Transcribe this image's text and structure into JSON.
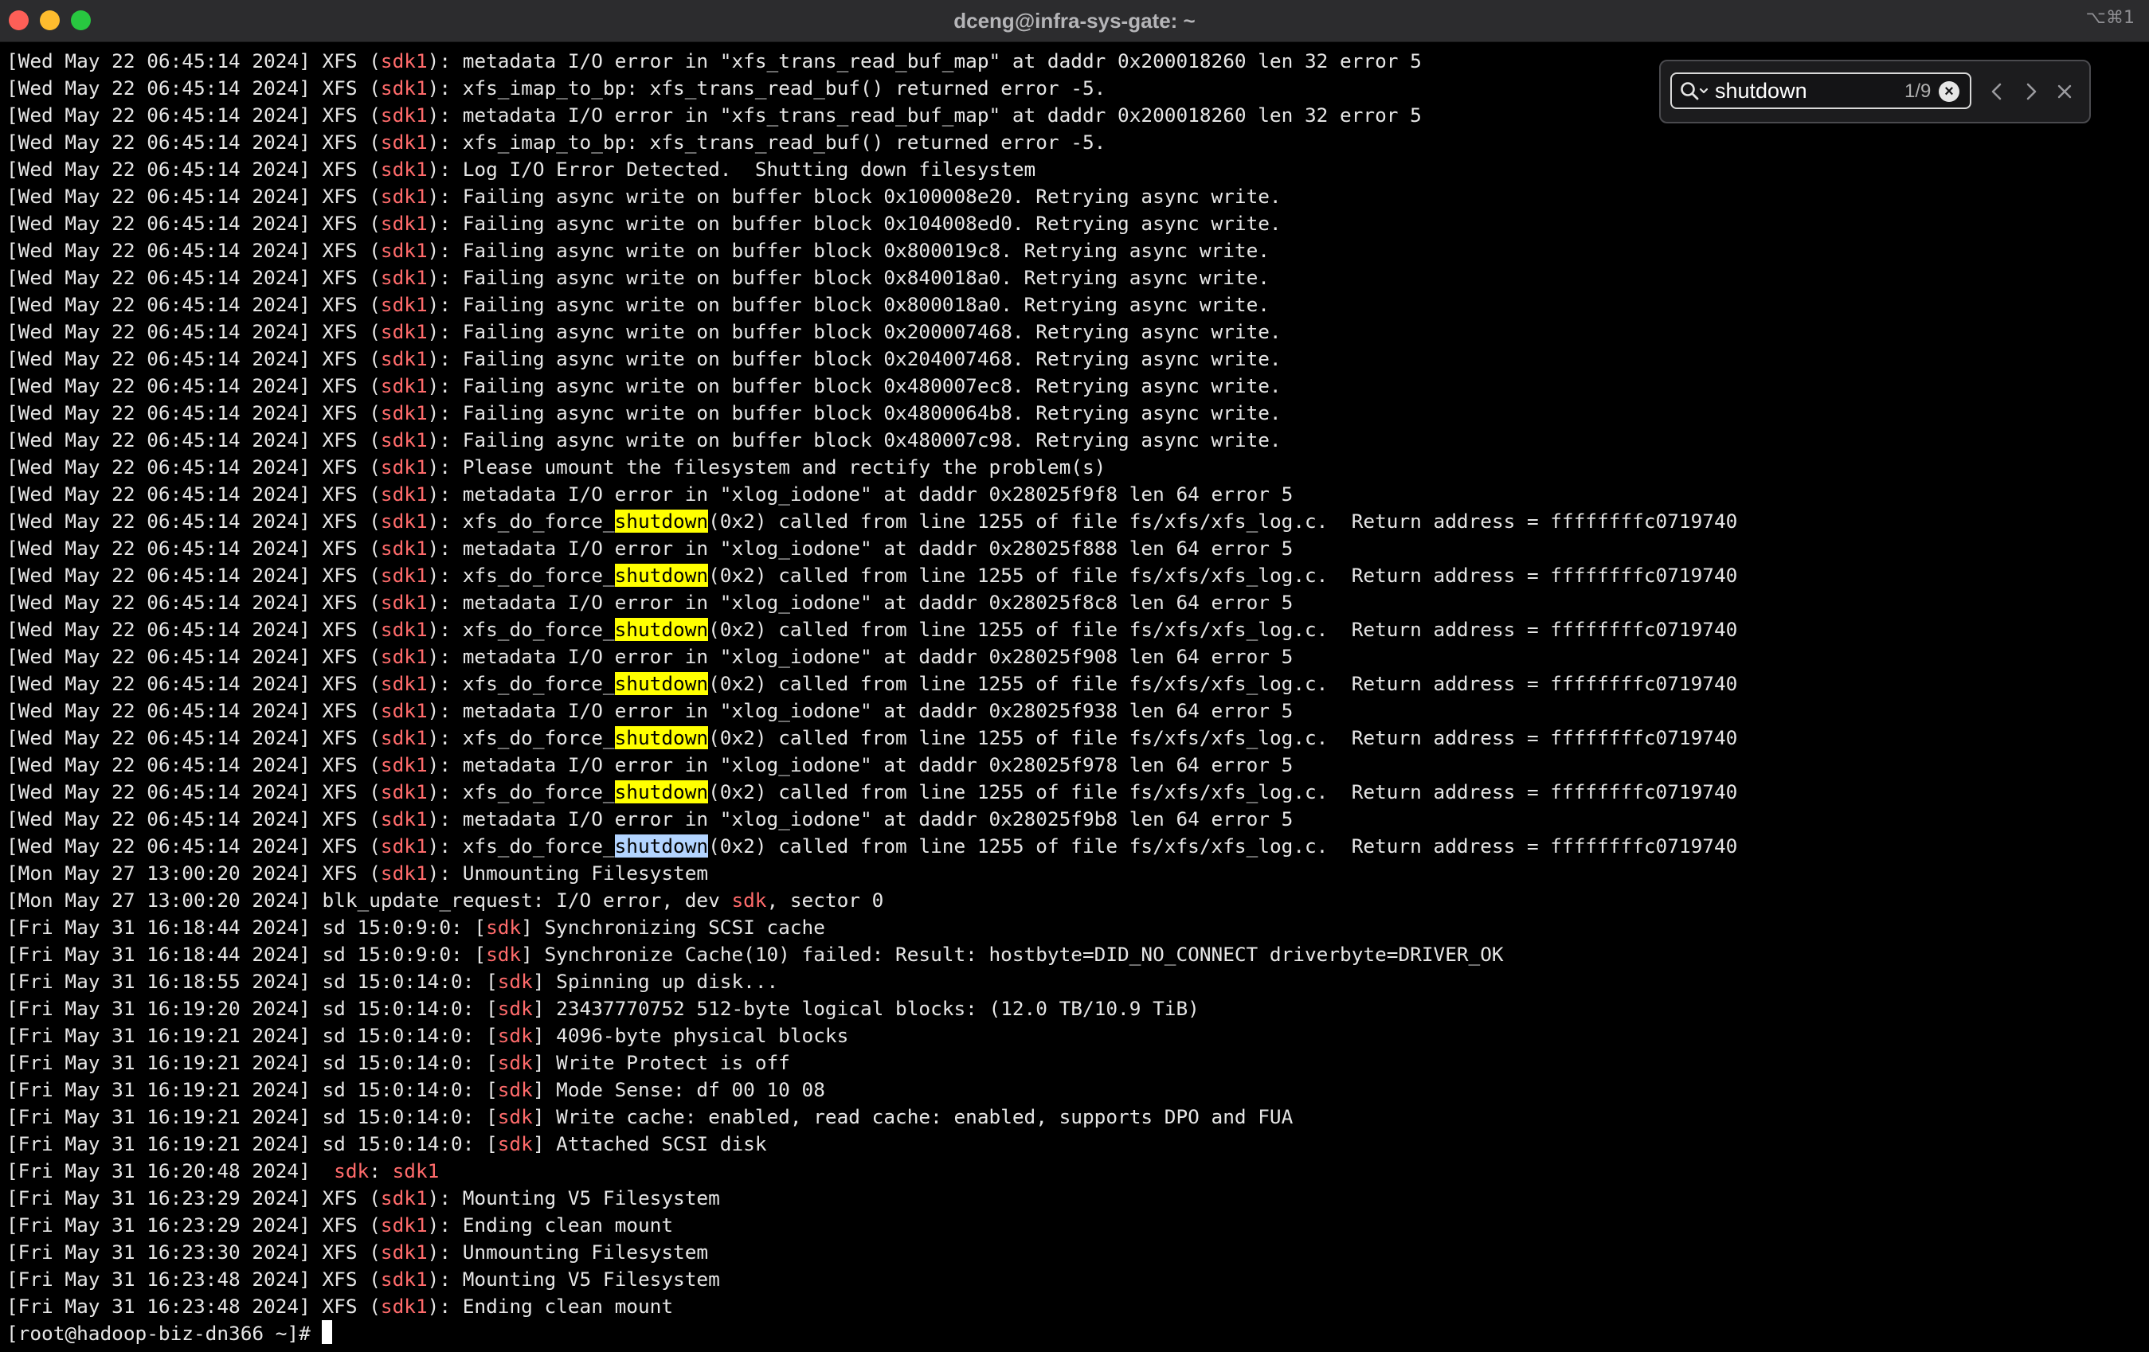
{
  "window": {
    "title": "dceng@infra-sys-gate: ~",
    "shortcut": "⌥⌘1"
  },
  "find": {
    "query": "shutdown",
    "count": "1/9",
    "clear_glyph": "×"
  },
  "prompt": "[root@hadoop-biz-dn366 ~]# ",
  "colors": {
    "highlight": "#ff6b6b",
    "match": "#ffff00",
    "current_match": "#b3d4ff"
  },
  "lines": [
    [
      {
        "t": "[Wed May 22 06:45:14 2024] XFS ("
      },
      {
        "t": "sdk1",
        "c": "hl"
      },
      {
        "t": "): metadata I/O error in \"xfs_trans_read_buf_map\" at daddr 0x200018260 len 32 error 5"
      }
    ],
    [
      {
        "t": "[Wed May 22 06:45:14 2024] XFS ("
      },
      {
        "t": "sdk1",
        "c": "hl"
      },
      {
        "t": "): xfs_imap_to_bp: xfs_trans_read_buf() returned error -5."
      }
    ],
    [
      {
        "t": "[Wed May 22 06:45:14 2024] XFS ("
      },
      {
        "t": "sdk1",
        "c": "hl"
      },
      {
        "t": "): metadata I/O error in \"xfs_trans_read_buf_map\" at daddr 0x200018260 len 32 error 5"
      }
    ],
    [
      {
        "t": "[Wed May 22 06:45:14 2024] XFS ("
      },
      {
        "t": "sdk1",
        "c": "hl"
      },
      {
        "t": "): xfs_imap_to_bp: xfs_trans_read_buf() returned error -5."
      }
    ],
    [
      {
        "t": "[Wed May 22 06:45:14 2024] XFS ("
      },
      {
        "t": "sdk1",
        "c": "hl"
      },
      {
        "t": "): Log I/O Error Detected.  Shutting down filesystem"
      }
    ],
    [
      {
        "t": "[Wed May 22 06:45:14 2024] XFS ("
      },
      {
        "t": "sdk1",
        "c": "hl"
      },
      {
        "t": "): Failing async write on buffer block 0x100008e20. Retrying async write."
      }
    ],
    [
      {
        "t": "[Wed May 22 06:45:14 2024] XFS ("
      },
      {
        "t": "sdk1",
        "c": "hl"
      },
      {
        "t": "): Failing async write on buffer block 0x104008ed0. Retrying async write."
      }
    ],
    [
      {
        "t": "[Wed May 22 06:45:14 2024] XFS ("
      },
      {
        "t": "sdk1",
        "c": "hl"
      },
      {
        "t": "): Failing async write on buffer block 0x800019c8. Retrying async write."
      }
    ],
    [
      {
        "t": "[Wed May 22 06:45:14 2024] XFS ("
      },
      {
        "t": "sdk1",
        "c": "hl"
      },
      {
        "t": "): Failing async write on buffer block 0x840018a0. Retrying async write."
      }
    ],
    [
      {
        "t": "[Wed May 22 06:45:14 2024] XFS ("
      },
      {
        "t": "sdk1",
        "c": "hl"
      },
      {
        "t": "): Failing async write on buffer block 0x800018a0. Retrying async write."
      }
    ],
    [
      {
        "t": "[Wed May 22 06:45:14 2024] XFS ("
      },
      {
        "t": "sdk1",
        "c": "hl"
      },
      {
        "t": "): Failing async write on buffer block 0x200007468. Retrying async write."
      }
    ],
    [
      {
        "t": "[Wed May 22 06:45:14 2024] XFS ("
      },
      {
        "t": "sdk1",
        "c": "hl"
      },
      {
        "t": "): Failing async write on buffer block 0x204007468. Retrying async write."
      }
    ],
    [
      {
        "t": "[Wed May 22 06:45:14 2024] XFS ("
      },
      {
        "t": "sdk1",
        "c": "hl"
      },
      {
        "t": "): Failing async write on buffer block 0x480007ec8. Retrying async write."
      }
    ],
    [
      {
        "t": "[Wed May 22 06:45:14 2024] XFS ("
      },
      {
        "t": "sdk1",
        "c": "hl"
      },
      {
        "t": "): Failing async write on buffer block 0x4800064b8. Retrying async write."
      }
    ],
    [
      {
        "t": "[Wed May 22 06:45:14 2024] XFS ("
      },
      {
        "t": "sdk1",
        "c": "hl"
      },
      {
        "t": "): Failing async write on buffer block 0x480007c98. Retrying async write."
      }
    ],
    [
      {
        "t": "[Wed May 22 06:45:14 2024] XFS ("
      },
      {
        "t": "sdk1",
        "c": "hl"
      },
      {
        "t": "): Please umount the filesystem and rectify the problem(s)"
      }
    ],
    [
      {
        "t": "[Wed May 22 06:45:14 2024] XFS ("
      },
      {
        "t": "sdk1",
        "c": "hl"
      },
      {
        "t": "): metadata I/O error in \"xlog_iodone\" at daddr 0x28025f9f8 len 64 error 5"
      }
    ],
    [
      {
        "t": "[Wed May 22 06:45:14 2024] XFS ("
      },
      {
        "t": "sdk1",
        "c": "hl"
      },
      {
        "t": "): xfs_do_force_"
      },
      {
        "t": "shutdown",
        "c": "match"
      },
      {
        "t": "(0x2) called from line 1255 of file fs/xfs/xfs_log.c.  Return address = ffffffffc0719740"
      }
    ],
    [
      {
        "t": "[Wed May 22 06:45:14 2024] XFS ("
      },
      {
        "t": "sdk1",
        "c": "hl"
      },
      {
        "t": "): metadata I/O error in \"xlog_iodone\" at daddr 0x28025f888 len 64 error 5"
      }
    ],
    [
      {
        "t": "[Wed May 22 06:45:14 2024] XFS ("
      },
      {
        "t": "sdk1",
        "c": "hl"
      },
      {
        "t": "): xfs_do_force_"
      },
      {
        "t": "shutdown",
        "c": "match"
      },
      {
        "t": "(0x2) called from line 1255 of file fs/xfs/xfs_log.c.  Return address = ffffffffc0719740"
      }
    ],
    [
      {
        "t": "[Wed May 22 06:45:14 2024] XFS ("
      },
      {
        "t": "sdk1",
        "c": "hl"
      },
      {
        "t": "): metadata I/O error in \"xlog_iodone\" at daddr 0x28025f8c8 len 64 error 5"
      }
    ],
    [
      {
        "t": "[Wed May 22 06:45:14 2024] XFS ("
      },
      {
        "t": "sdk1",
        "c": "hl"
      },
      {
        "t": "): xfs_do_force_"
      },
      {
        "t": "shutdown",
        "c": "match"
      },
      {
        "t": "(0x2) called from line 1255 of file fs/xfs/xfs_log.c.  Return address = ffffffffc0719740"
      }
    ],
    [
      {
        "t": "[Wed May 22 06:45:14 2024] XFS ("
      },
      {
        "t": "sdk1",
        "c": "hl"
      },
      {
        "t": "): metadata I/O error in \"xlog_iodone\" at daddr 0x28025f908 len 64 error 5"
      }
    ],
    [
      {
        "t": "[Wed May 22 06:45:14 2024] XFS ("
      },
      {
        "t": "sdk1",
        "c": "hl"
      },
      {
        "t": "): xfs_do_force_"
      },
      {
        "t": "shutdown",
        "c": "match"
      },
      {
        "t": "(0x2) called from line 1255 of file fs/xfs/xfs_log.c.  Return address = ffffffffc0719740"
      }
    ],
    [
      {
        "t": "[Wed May 22 06:45:14 2024] XFS ("
      },
      {
        "t": "sdk1",
        "c": "hl"
      },
      {
        "t": "): metadata I/O error in \"xlog_iodone\" at daddr 0x28025f938 len 64 error 5"
      }
    ],
    [
      {
        "t": "[Wed May 22 06:45:14 2024] XFS ("
      },
      {
        "t": "sdk1",
        "c": "hl"
      },
      {
        "t": "): xfs_do_force_"
      },
      {
        "t": "shutdown",
        "c": "match"
      },
      {
        "t": "(0x2) called from line 1255 of file fs/xfs/xfs_log.c.  Return address = ffffffffc0719740"
      }
    ],
    [
      {
        "t": "[Wed May 22 06:45:14 2024] XFS ("
      },
      {
        "t": "sdk1",
        "c": "hl"
      },
      {
        "t": "): metadata I/O error in \"xlog_iodone\" at daddr 0x28025f978 len 64 error 5"
      }
    ],
    [
      {
        "t": "[Wed May 22 06:45:14 2024] XFS ("
      },
      {
        "t": "sdk1",
        "c": "hl"
      },
      {
        "t": "): xfs_do_force_"
      },
      {
        "t": "shutdown",
        "c": "match"
      },
      {
        "t": "(0x2) called from line 1255 of file fs/xfs/xfs_log.c.  Return address = ffffffffc0719740"
      }
    ],
    [
      {
        "t": "[Wed May 22 06:45:14 2024] XFS ("
      },
      {
        "t": "sdk1",
        "c": "hl"
      },
      {
        "t": "): metadata I/O error in \"xlog_iodone\" at daddr 0x28025f9b8 len 64 error 5"
      }
    ],
    [
      {
        "t": "[Wed May 22 06:45:14 2024] XFS ("
      },
      {
        "t": "sdk1",
        "c": "hl"
      },
      {
        "t": "): xfs_do_force_"
      },
      {
        "t": "shutdown",
        "c": "match current"
      },
      {
        "t": "(0x2) called from line 1255 of file fs/xfs/xfs_log.c.  Return address = ffffffffc0719740"
      }
    ],
    [
      {
        "t": "[Mon May 27 13:00:20 2024] XFS ("
      },
      {
        "t": "sdk1",
        "c": "hl"
      },
      {
        "t": "): Unmounting Filesystem"
      }
    ],
    [
      {
        "t": "[Mon May 27 13:00:20 2024] blk_update_request: I/O error, dev "
      },
      {
        "t": "sdk",
        "c": "hl"
      },
      {
        "t": ", sector 0"
      }
    ],
    [
      {
        "t": "[Fri May 31 16:18:44 2024] sd 15:0:9:0: ["
      },
      {
        "t": "sdk",
        "c": "hl"
      },
      {
        "t": "] Synchronizing SCSI cache"
      }
    ],
    [
      {
        "t": "[Fri May 31 16:18:44 2024] sd 15:0:9:0: ["
      },
      {
        "t": "sdk",
        "c": "hl"
      },
      {
        "t": "] Synchronize Cache(10) failed: Result: hostbyte=DID_NO_CONNECT driverbyte=DRIVER_OK"
      }
    ],
    [
      {
        "t": "[Fri May 31 16:18:55 2024] sd 15:0:14:0: ["
      },
      {
        "t": "sdk",
        "c": "hl"
      },
      {
        "t": "] Spinning up disk..."
      }
    ],
    [
      {
        "t": "[Fri May 31 16:19:20 2024] sd 15:0:14:0: ["
      },
      {
        "t": "sdk",
        "c": "hl"
      },
      {
        "t": "] 23437770752 512-byte logical blocks: (12.0 TB/10.9 TiB)"
      }
    ],
    [
      {
        "t": "[Fri May 31 16:19:21 2024] sd 15:0:14:0: ["
      },
      {
        "t": "sdk",
        "c": "hl"
      },
      {
        "t": "] 4096-byte physical blocks"
      }
    ],
    [
      {
        "t": "[Fri May 31 16:19:21 2024] sd 15:0:14:0: ["
      },
      {
        "t": "sdk",
        "c": "hl"
      },
      {
        "t": "] Write Protect is off"
      }
    ],
    [
      {
        "t": "[Fri May 31 16:19:21 2024] sd 15:0:14:0: ["
      },
      {
        "t": "sdk",
        "c": "hl"
      },
      {
        "t": "] Mode Sense: df 00 10 08"
      }
    ],
    [
      {
        "t": "[Fri May 31 16:19:21 2024] sd 15:0:14:0: ["
      },
      {
        "t": "sdk",
        "c": "hl"
      },
      {
        "t": "] Write cache: enabled, read cache: enabled, supports DPO and FUA"
      }
    ],
    [
      {
        "t": "[Fri May 31 16:19:21 2024] sd 15:0:14:0: ["
      },
      {
        "t": "sdk",
        "c": "hl"
      },
      {
        "t": "] Attached SCSI disk"
      }
    ],
    [
      {
        "t": "[Fri May 31 16:20:48 2024]  "
      },
      {
        "t": "sdk",
        "c": "hl"
      },
      {
        "t": ": "
      },
      {
        "t": "sdk1",
        "c": "hl"
      }
    ],
    [
      {
        "t": "[Fri May 31 16:23:29 2024] XFS ("
      },
      {
        "t": "sdk1",
        "c": "hl"
      },
      {
        "t": "): Mounting V5 Filesystem"
      }
    ],
    [
      {
        "t": "[Fri May 31 16:23:29 2024] XFS ("
      },
      {
        "t": "sdk1",
        "c": "hl"
      },
      {
        "t": "): Ending clean mount"
      }
    ],
    [
      {
        "t": "[Fri May 31 16:23:30 2024] XFS ("
      },
      {
        "t": "sdk1",
        "c": "hl"
      },
      {
        "t": "): Unmounting Filesystem"
      }
    ],
    [
      {
        "t": "[Fri May 31 16:23:48 2024] XFS ("
      },
      {
        "t": "sdk1",
        "c": "hl"
      },
      {
        "t": "): Mounting V5 Filesystem"
      }
    ],
    [
      {
        "t": "[Fri May 31 16:23:48 2024] XFS ("
      },
      {
        "t": "sdk1",
        "c": "hl"
      },
      {
        "t": "): Ending clean mount"
      }
    ]
  ]
}
